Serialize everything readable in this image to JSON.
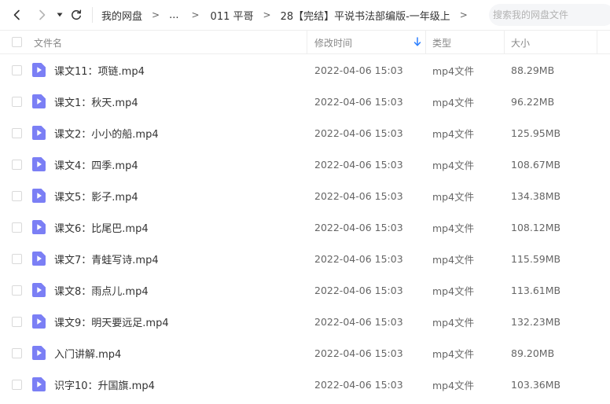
{
  "toolbar": {
    "back_icon": "chevron-left-icon",
    "forward_icon": "chevron-right-icon",
    "history_icon": "caret-down-icon",
    "refresh_icon": "refresh-icon"
  },
  "breadcrumb": {
    "items": [
      "我的网盘",
      "...",
      "011 平哥",
      "28【完结】平说书法部编版-一年级上"
    ],
    "separator": ">"
  },
  "search": {
    "placeholder": "搜索我的网盘文件",
    "value": ""
  },
  "table": {
    "headers": {
      "name": "文件名",
      "modified": "修改时间",
      "type": "类型",
      "size": "大小"
    },
    "sort": {
      "column": "modified",
      "direction": "desc",
      "icon": "arrow-down-icon"
    },
    "accent_color": "#2b7fff",
    "file_icon_color": "#7b7ff5",
    "rows": [
      {
        "name": "课文11：项链.mp4",
        "modified": "2022-04-06 15:03",
        "type": "mp4文件",
        "size": "88.29MB"
      },
      {
        "name": "课文1：秋天.mp4",
        "modified": "2022-04-06 15:03",
        "type": "mp4文件",
        "size": "96.22MB"
      },
      {
        "name": "课文2：小小的船.mp4",
        "modified": "2022-04-06 15:03",
        "type": "mp4文件",
        "size": "125.95MB"
      },
      {
        "name": "课文4：四季.mp4",
        "modified": "2022-04-06 15:03",
        "type": "mp4文件",
        "size": "108.67MB"
      },
      {
        "name": "课文5：影子.mp4",
        "modified": "2022-04-06 15:03",
        "type": "mp4文件",
        "size": "134.38MB"
      },
      {
        "name": "课文6：比尾巴.mp4",
        "modified": "2022-04-06 15:03",
        "type": "mp4文件",
        "size": "108.12MB"
      },
      {
        "name": "课文7：青蛙写诗.mp4",
        "modified": "2022-04-06 15:03",
        "type": "mp4文件",
        "size": "115.59MB"
      },
      {
        "name": "课文8：雨点儿.mp4",
        "modified": "2022-04-06 15:03",
        "type": "mp4文件",
        "size": "113.61MB"
      },
      {
        "name": "课文9：明天要远足.mp4",
        "modified": "2022-04-06 15:03",
        "type": "mp4文件",
        "size": "132.23MB"
      },
      {
        "name": "入门讲解.mp4",
        "modified": "2022-04-06 15:03",
        "type": "mp4文件",
        "size": "89.20MB"
      },
      {
        "name": "识字10：升国旗.mp4",
        "modified": "2022-04-06 15:03",
        "type": "mp4文件",
        "size": "103.36MB"
      }
    ]
  }
}
